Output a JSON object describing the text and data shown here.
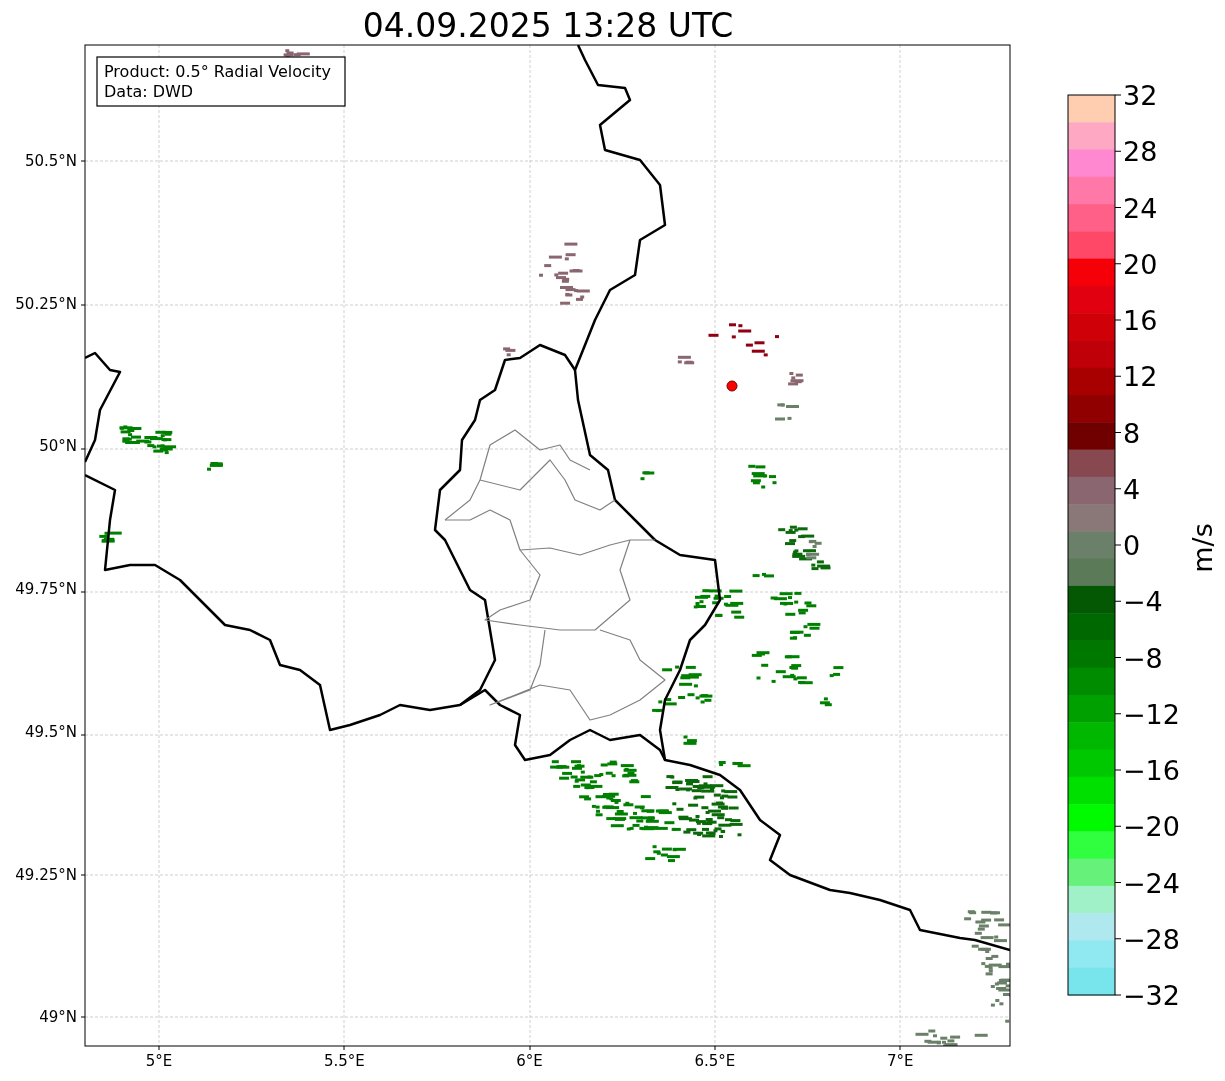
{
  "title": "04.09.2025 13:28 UTC",
  "info_box": {
    "lines": [
      "Product: 0.5° Radial Velocity",
      "Data: DWD"
    ]
  },
  "map": {
    "x_ticks": [
      "5°E",
      "5.5°E",
      "6°E",
      "6.5°E",
      "7°E"
    ],
    "y_ticks": [
      "50.5°N",
      "50.25°N",
      "50°N",
      "49.75°N",
      "49.5°N",
      "49.25°N",
      "49°N"
    ]
  },
  "colorbar": {
    "label": "m/s",
    "ticks": [
      "32",
      "28",
      "24",
      "20",
      "16",
      "12",
      "8",
      "4",
      "0",
      "−4",
      "−8",
      "−12",
      "−16",
      "−20",
      "−24",
      "−28",
      "−32"
    ],
    "bands": [
      {
        "color": "#ffcdb0"
      },
      {
        "color": "#ffa8c4"
      },
      {
        "color": "#ff88d0"
      },
      {
        "color": "#ff78a8"
      },
      {
        "color": "#ff6088"
      },
      {
        "color": "#ff4868"
      },
      {
        "color": "#f50008"
      },
      {
        "color": "#e00010"
      },
      {
        "color": "#d00008"
      },
      {
        "color": "#c00008"
      },
      {
        "color": "#a80000"
      },
      {
        "color": "#900000"
      },
      {
        "color": "#700000"
      },
      {
        "color": "#884850"
      },
      {
        "color": "#8a6670"
      },
      {
        "color": "#8a7878"
      },
      {
        "color": "#6b8068"
      },
      {
        "color": "#5a7a58"
      },
      {
        "color": "#045804"
      },
      {
        "color": "#006800"
      },
      {
        "color": "#007800"
      },
      {
        "color": "#008c00"
      },
      {
        "color": "#00a000"
      },
      {
        "color": "#00b800"
      },
      {
        "color": "#00c800"
      },
      {
        "color": "#00e000"
      },
      {
        "color": "#00fa00"
      },
      {
        "color": "#30ff40"
      },
      {
        "color": "#66f27a"
      },
      {
        "color": "#a0f0c8"
      },
      {
        "color": "#b0e8f0"
      },
      {
        "color": "#90e8f0"
      },
      {
        "color": "#78e4ec"
      }
    ]
  }
}
